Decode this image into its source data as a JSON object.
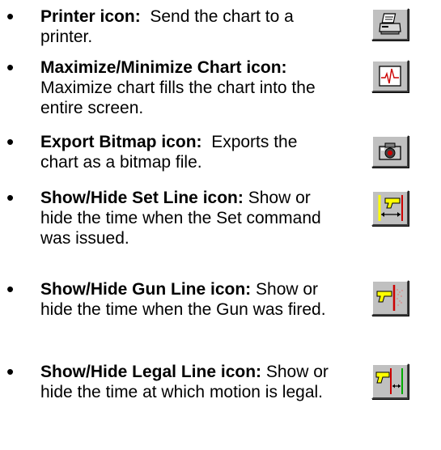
{
  "items": [
    {
      "bullet": "•",
      "title": "Printer icon:",
      "text": "Send the chart to a printer.",
      "icon": "printer-icon"
    },
    {
      "bullet": "•",
      "title": "Maximize/Minimize Chart icon:",
      "text": "Maximize chart fills the chart into the entire screen.",
      "icon": "maximize-chart-icon"
    },
    {
      "bullet": "•",
      "title": "Export Bitmap icon:",
      "text": "Exports the chart as a bitmap file.",
      "icon": "camera-icon"
    },
    {
      "bullet": "•",
      "title": "Show/Hide Set Line icon:",
      "text": "Show or hide the time when the Set command was issued.",
      "icon": "set-line-icon"
    },
    {
      "bullet": "•",
      "title": "Show/Hide Gun Line icon:",
      "text": "Show or hide the time when the Gun was fired.",
      "icon": "gun-line-icon"
    },
    {
      "bullet": "•",
      "title": "Show/Hide Legal Line icon:",
      "text": "Show or hide the time at which motion is legal.",
      "icon": "legal-line-icon"
    }
  ],
  "colors": {
    "button_face": "#c0c0c0",
    "chart_line": "#cc0000",
    "set_line": "#ffff00",
    "gun_yellow": "#ffff00",
    "legal_line": "#00aa00"
  }
}
